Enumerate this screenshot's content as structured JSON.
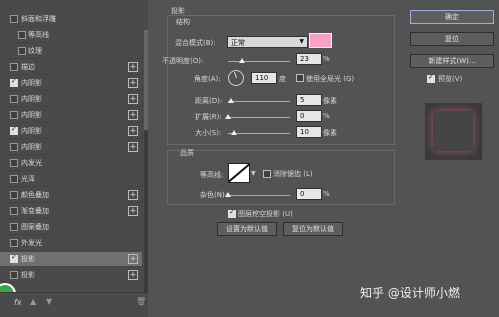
{
  "left_panel": {
    "items": [
      {
        "label": "斜面和浮雕",
        "checked": false,
        "indent": false,
        "plus": false
      },
      {
        "label": "等高线",
        "checked": false,
        "indent": true,
        "plus": false
      },
      {
        "label": "纹理",
        "checked": false,
        "indent": true,
        "plus": false
      },
      {
        "label": "描边",
        "checked": false,
        "indent": false,
        "plus": true
      },
      {
        "label": "内阴影",
        "checked": true,
        "indent": false,
        "plus": true
      },
      {
        "label": "内阴影",
        "checked": false,
        "indent": false,
        "plus": true
      },
      {
        "label": "内阴影",
        "checked": false,
        "indent": false,
        "plus": true
      },
      {
        "label": "内阴影",
        "checked": true,
        "indent": false,
        "plus": true
      },
      {
        "label": "内阴影",
        "checked": false,
        "indent": false,
        "plus": true
      },
      {
        "label": "内发光",
        "checked": false,
        "indent": false,
        "plus": false
      },
      {
        "label": "光泽",
        "checked": false,
        "indent": false,
        "plus": false
      },
      {
        "label": "颜色叠加",
        "checked": false,
        "indent": false,
        "plus": true
      },
      {
        "label": "渐变叠加",
        "checked": false,
        "indent": false,
        "plus": true
      },
      {
        "label": "图案叠加",
        "checked": false,
        "indent": false,
        "plus": false
      },
      {
        "label": "外发光",
        "checked": false,
        "indent": false,
        "plus": false
      },
      {
        "label": "投影",
        "checked": true,
        "indent": false,
        "plus": true,
        "selected": true
      },
      {
        "label": "投影",
        "checked": false,
        "indent": false,
        "plus": true
      }
    ],
    "fx": "fx"
  },
  "shadow": {
    "title": "投影",
    "structure_title": "结构",
    "blend_mode_label": "混合模式(B):",
    "blend_mode_value": "正常",
    "color": "#f7a1c4",
    "opacity_label": "不透明度(O):",
    "opacity_value": "23",
    "opacity_pct": 23,
    "angle_label": "角度(A):",
    "angle_value": "110",
    "angle_unit": "度",
    "global_light_label": "使用全局光 (G)",
    "distance_label": "距离(D):",
    "distance_value": "5",
    "distance_pct": 5,
    "spread_label": "扩展(R):",
    "spread_value": "0",
    "spread_pct": 0,
    "size_label": "大小(S):",
    "size_value": "10",
    "size_pct": 10,
    "unit_px": "像素",
    "unit_pct": "%",
    "quality_title": "品质",
    "contour_label": "等高线:",
    "antialias_label": "消除锯齿 (L)",
    "noise_label": "杂色(N):",
    "noise_value": "0",
    "noise_pct": 0,
    "knockout_label": "图层挖空投影 (U)",
    "set_default": "设置为默认值",
    "reset_default": "复位为默认值"
  },
  "right_panel": {
    "ok": "确定",
    "reset": "复位",
    "new_style": "新建样式(W)...",
    "preview_label": "预览(V)"
  },
  "watermark": "知乎 @设计师小燃"
}
